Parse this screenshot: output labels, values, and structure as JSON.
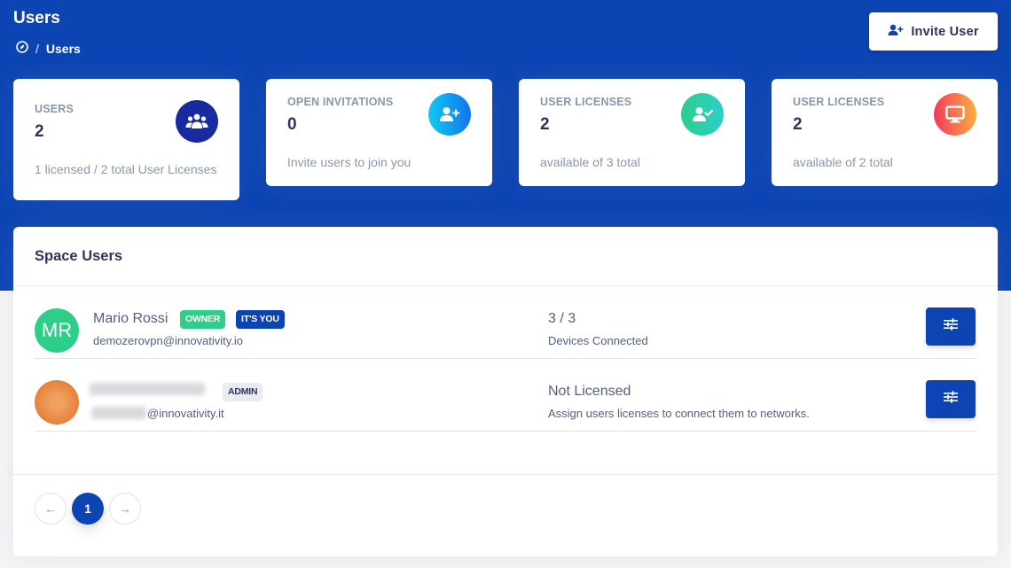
{
  "header": {
    "title": "Users",
    "breadcrumb_separator": "/",
    "breadcrumb_current": "Users",
    "invite_button_label": "Invite User"
  },
  "stats": [
    {
      "label": "USERS",
      "value": "2",
      "description": "1 licensed / 2 total User Licenses",
      "icon": "users-icon",
      "color": "#172b9e"
    },
    {
      "label": "OPEN INVITATIONS",
      "value": "0",
      "description": "Invite users to join you",
      "icon": "user-plus-icon",
      "color": "#11b6f2"
    },
    {
      "label": "USER LICENSES",
      "value": "2",
      "description": "available of 3 total",
      "icon": "user-check-icon",
      "color": "#2dce89"
    },
    {
      "label": "USER LICENSES",
      "value": "2",
      "description": "available of 2 total",
      "icon": "monitor-icon",
      "color": "#fb6340"
    }
  ],
  "space_users": {
    "title": "Space Users",
    "users": [
      {
        "initials": "MR",
        "name": "Mario Rossi",
        "email": "demozerovpn@innovativity.io",
        "badges": [
          "OWNER",
          "IT'S YOU"
        ],
        "device_main": "3 / 3",
        "device_sub": "Devices Connected"
      },
      {
        "name": "",
        "email": "@innovativity.it",
        "badges": [
          "ADMIN"
        ],
        "device_main": "Not Licensed",
        "device_sub": "Assign users licenses to connect them to networks."
      }
    ]
  },
  "pagination": {
    "prev": "←",
    "current": "1",
    "next": "→"
  },
  "colors": {
    "primary": "#0c44b4",
    "owner_badge": "#2dce89",
    "you_badge": "#0c44b4",
    "admin_badge": "#e9ecef"
  }
}
